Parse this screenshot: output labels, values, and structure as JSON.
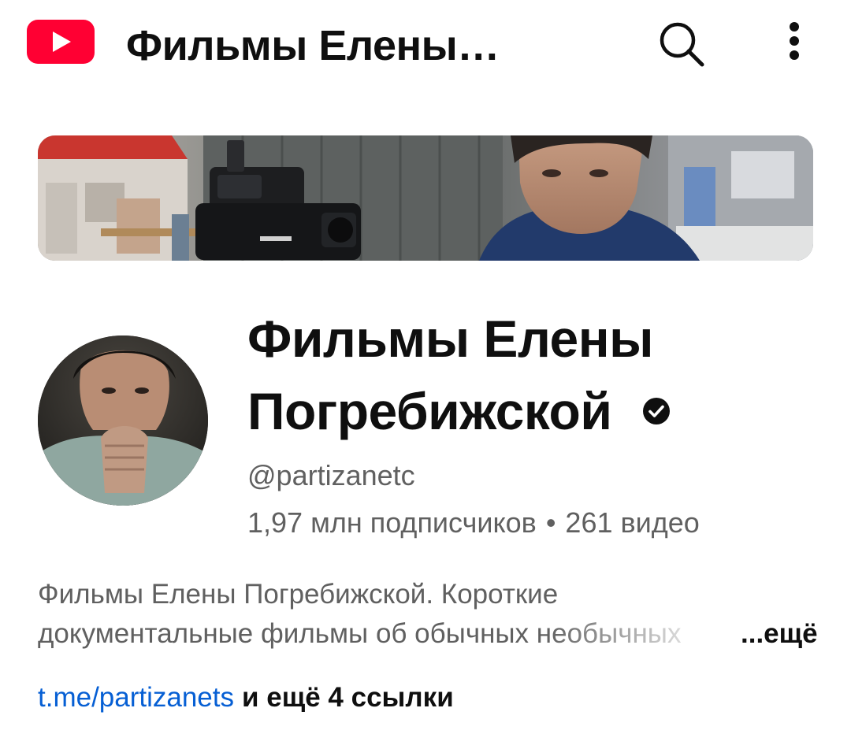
{
  "app": {
    "logo_icon": "youtube-logo-icon",
    "accent": "#ff0000"
  },
  "topbar": {
    "title": "Фильмы Елены…",
    "search_icon": "search-icon",
    "more_icon": "more-vert-icon"
  },
  "channel": {
    "name_line1": "Фильмы Елены",
    "name_line2": "Погребижской",
    "verified_icon": "verified-check-icon",
    "handle": "@partizanetc",
    "subscribers": "1,97 млн подписчиков",
    "separator": "•",
    "videos": "261 видео"
  },
  "description": {
    "line1": "Фильмы Елены Погребижской. Короткие",
    "line2": "документальные фильмы об обычных необычных",
    "more_label": "...ещё"
  },
  "links": {
    "primary": "t.me/partizanets",
    "extra": "и ещё 4 ссылки",
    "link_color": "#065fd4"
  },
  "colors": {
    "text_primary": "#0f0f0f",
    "text_secondary": "#606060"
  }
}
